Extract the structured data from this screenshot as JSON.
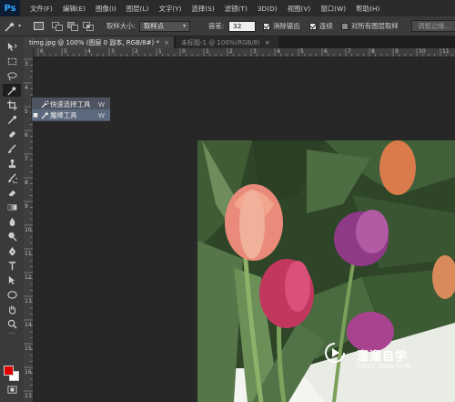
{
  "app": {
    "logo": "Ps"
  },
  "menu": [
    "文件(F)",
    "编辑(E)",
    "图像(I)",
    "图层(L)",
    "文字(Y)",
    "选择(S)",
    "滤镜(T)",
    "3D(D)",
    "视图(V)",
    "窗口(W)",
    "帮助(H)"
  ],
  "options": {
    "sample_size_label": "取样大小:",
    "sample_size_value": "取样点",
    "tolerance_label": "容差:",
    "tolerance_value": "32",
    "antialias_label": "消除锯齿",
    "antialias_checked": true,
    "contiguous_label": "连续",
    "contiguous_checked": true,
    "all_layers_label": "对所有图层取样",
    "all_layers_checked": false,
    "refine_edge_label": "调整边缘..."
  },
  "tabs": [
    {
      "label": "timg.jpg @ 100% (图层 0 副本, RGB/8#) *",
      "close": "×",
      "active": true
    },
    {
      "label": "未标题-1 @ 100%(RGB/8)",
      "close": "×",
      "active": false
    }
  ],
  "ruler": {
    "h_numbers": [
      "6",
      "5",
      "4",
      "3",
      "2",
      "1",
      "0",
      "1",
      "2",
      "3",
      "4",
      "5",
      "6",
      "7",
      "8",
      "9",
      "10",
      "11"
    ],
    "v_numbers": [
      "3",
      "4",
      "5",
      "6",
      "7",
      "8",
      "9",
      "10",
      "11",
      "12",
      "13",
      "14",
      "15",
      "16",
      "17"
    ]
  },
  "flyout": {
    "items": [
      {
        "label": "快速选择工具",
        "shortcut": "W",
        "selected": false
      },
      {
        "label": "魔棒工具",
        "shortcut": "W",
        "selected": true
      }
    ]
  },
  "colors": {
    "foreground": "#e00000",
    "background": "#ffffff",
    "accent": "#31a8ff"
  },
  "watermark": {
    "name": "溜溜自学",
    "url": "ZIXUE.3D66.COM"
  }
}
